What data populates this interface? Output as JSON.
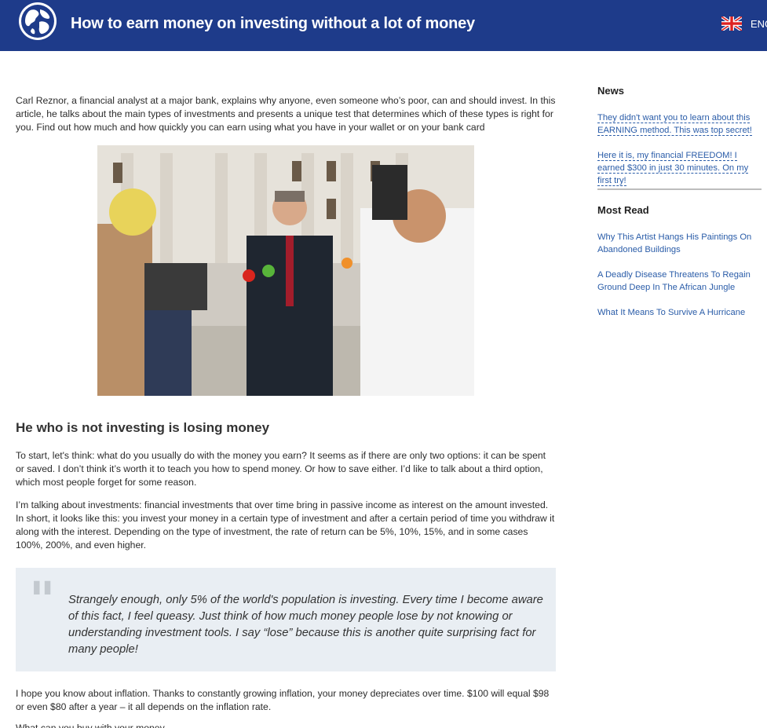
{
  "header": {
    "title": "How to earn money on investing without a lot of money",
    "language": "ENG",
    "logo_icon": "globe-icon",
    "flag_icon": "uk-flag-icon",
    "background_color": "#1e3b8a"
  },
  "article": {
    "intro": "Carl Reznor, a financial analyst at a major bank, explains why anyone, even someone who’s poor, can and should invest. In this article, he talks about the main types of investments and presents a unique test that determines which of these types is right for you. Find out how much and how quickly you can earn using what you have in your wallet or on your bank card",
    "heading": "He who is not investing is losing money",
    "paragraphs": [
      "To start, let's think: what do you usually do with the money you earn? It seems as if there are only two options: it can be spent or saved. I don’t think it’s worth it to teach you how to spend money. Or how to save either. I’d like to talk about a third option, which most people forget for some reason.",
      "I’m talking about investments: financial investments that over time bring in passive income as interest on the amount invested. In short, it looks like this: you invest your money in a certain type of investment and after a certain period of time you withdraw it along with the interest. Depending on the type of investment, the rate of return can be 5%, 10%, 15%, and in some cases 100%, 200%, and even higher.",
      "I hope you know about inflation. Thanks to constantly growing inflation, your money depreciates over time. $100 will equal $98 or even $80 after a year – it all depends on the inflation rate.",
      "What can you buy with your money"
    ],
    "quote": "Strangely enough, only 5% of the world's population is investing. Every time I become aware of this fact, I feel queasy. Just think of how much money people lose by not knowing or understanding investment tools. I say “lose” because this is another quite surprising fact for many people!"
  },
  "sidebar": {
    "news_heading": "News",
    "news": [
      "They didn't want you to learn about this EARNING method. This was top secret!",
      "Here it is, my financial FREEDOM! I earned $300 in just 30 minutes. On my first try!"
    ],
    "most_read_heading": "Most Read",
    "most_read": [
      "Why This Artist Hangs His Paintings On Abandoned Buildings",
      "A Deadly Disease Threatens To Regain Ground Deep In The African Jungle",
      "What It Means To Survive A Hurricane"
    ],
    "link_color": "#2a5ca8"
  }
}
